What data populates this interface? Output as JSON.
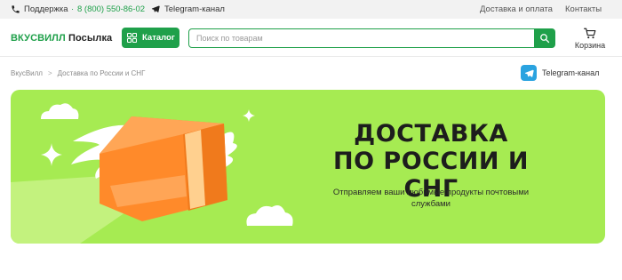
{
  "topbar": {
    "support_label": "Поддержка",
    "dot": "·",
    "phone_number": "8 (800) 550-86-02",
    "telegram_label": "Telegram-канал",
    "delivery_label": "Доставка и оплата",
    "contacts_label": "Контакты"
  },
  "header": {
    "logo_brand": "ВКУСВИЛЛ",
    "logo_suffix": "Посылка",
    "catalog_label": "Каталог",
    "search_placeholder": "Поиск по товарам",
    "search_value": "",
    "cart_label": "Корзина"
  },
  "breadcrumb": {
    "items": [
      "ВкусВилл",
      "Доставка по России и СНГ"
    ],
    "separator": ">"
  },
  "telegram_pill": {
    "label": "Telegram-канал"
  },
  "banner": {
    "title_line1": "ДОСТАВКА",
    "title_line2": "ПО РОССИИ И СНГ",
    "subtitle": "Отправляем ваши любимые продукты почтовыми службами"
  },
  "colors": {
    "brand_green": "#1fa04a",
    "banner_bg": "#a6eb52",
    "box_orange": "#ff8a2a",
    "telegram_blue": "#2aa3e0"
  },
  "icons": [
    "phone-icon",
    "telegram-icon",
    "grid-icon",
    "search-icon",
    "cart-icon",
    "telegram-icon"
  ]
}
